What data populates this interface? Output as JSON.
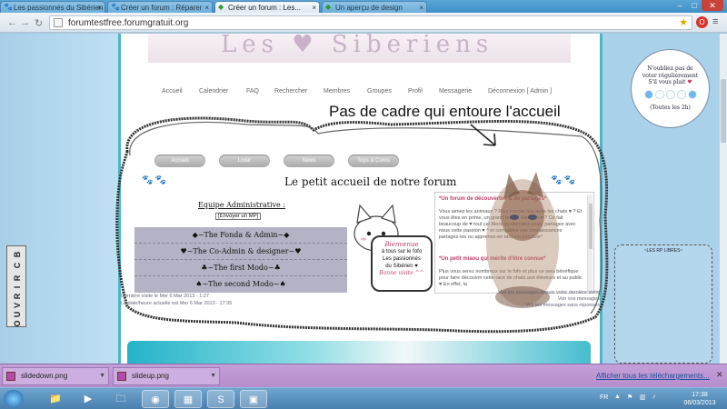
{
  "browser": {
    "tabs": [
      {
        "label": "Les passionnés du Sibérien !",
        "active": false,
        "icon": "paw-icon"
      },
      {
        "label": "Créer un forum : Réparer",
        "active": false,
        "icon": "paw-icon"
      },
      {
        "label": "Créer un forum : Les...",
        "active": true,
        "icon": "forumactif-icon"
      },
      {
        "label": "Un aperçu de design",
        "active": false,
        "icon": "forumactif-icon"
      }
    ],
    "url": "forumtestfree.forumgratuit.org"
  },
  "nav": {
    "links": [
      "Accueil",
      "Calendrier",
      "FAQ",
      "Rechercher",
      "Membres",
      "Groupes",
      "Profil",
      "Messagerie",
      "Déconnexion [ Admin ]"
    ]
  },
  "annotation": "Pas de cadre qui entoure l'accueil",
  "home": {
    "tab_pills": [
      "Accueil",
      "Loisir",
      "News",
      "Tops & Coms"
    ],
    "title": "Le petit accueil de notre forum",
    "team_heading": "Equipe Administrative :",
    "mp_button": "[Envoyer un MP]",
    "staff": [
      "◆~The Fonda & Admin~◆",
      "♥~The Co-Admin & designer~♥",
      "♣~The first Modo~♣",
      "♠~The second Modo~♠"
    ],
    "bubble": {
      "line1": "Bienvenue",
      "line2": "à tous sur le fofo",
      "line3": "Les passionnés",
      "line4": "du Sibérien ♥",
      "line5": "Bonne visite ^^"
    },
    "welcome": {
      "heading1": "*Un forum de découvertes & de partages*",
      "para1": "Vous aimez les animaux ? Plus encore nos amis les chats ♥ ? Et vous êtes en prime, un grand fan de Sibérien ♥ ? Ce fait beaucoup de ♥ tout ça! Alors qu'attendez-vous, partagez avec nous cette passion ♥ ^ et complétez vos connaissances partagez-les ou apprenez-en tant est possible^",
      "heading2": "*Un petit miaou qui mérite d'être connue*",
      "para2": "Plus vous serez nombreux sur le fofo et plus ce sera bénéfique pour faire découvrir cette race de chats aux éleveurs et au public ♥ En effet, la"
    }
  },
  "footer": {
    "last_visit": "Dernière visite le Mer 6 Mar 2013 - 1:27",
    "now": "La date/heure actuelle est Mer 6 Mar 2013 - 17:35",
    "right1": "Voir les messages depuis votre dernière visite",
    "right2": "Voir vos messages",
    "right3": "Voir les messages sans réponses"
  },
  "widget": {
    "line1": "N'oubliez pas de",
    "line2": "voter régulièrement",
    "line3": "S'il vous plait",
    "heart": "♥",
    "line4": "(Toutes les 2h)",
    "dots": [
      "blue",
      "white",
      "white",
      "white",
      "blue"
    ]
  },
  "rp_box": {
    "label": "~LES RP LIBRES~"
  },
  "side_tab": {
    "letters": [
      "O",
      "U",
      "V",
      "R",
      "I",
      "R",
      "C",
      "B"
    ]
  },
  "downloads": {
    "items": [
      "slidedown.png",
      "slideup.png"
    ],
    "show_all": "Afficher tous les téléchargements..."
  },
  "taskbar": {
    "lang": "FR",
    "time": "17:38",
    "date": "06/03/2013"
  }
}
